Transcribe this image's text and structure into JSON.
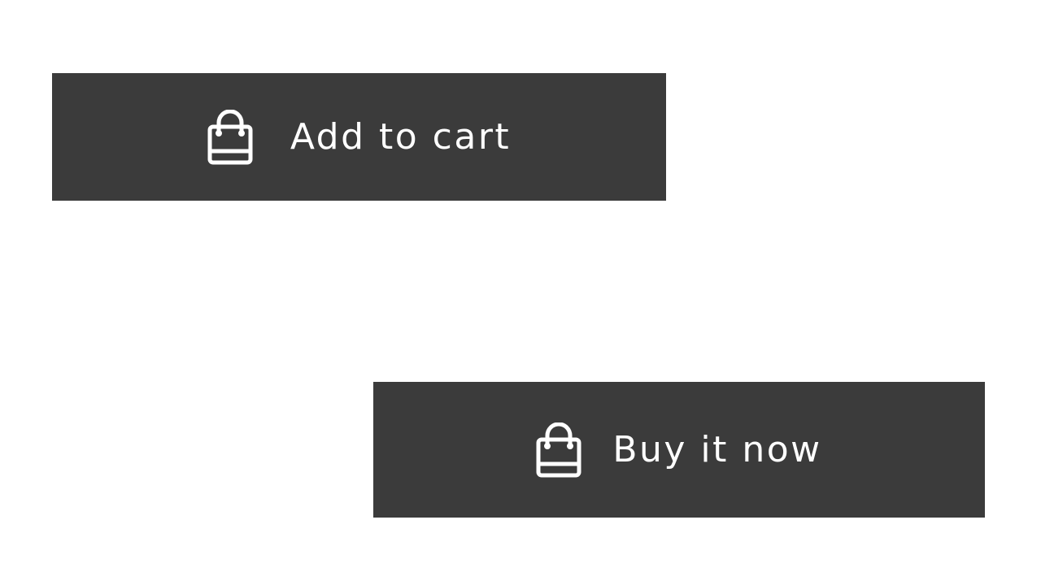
{
  "buttons": {
    "add_to_cart": {
      "label": "Add to cart",
      "icon": "shopping-bag-icon"
    },
    "buy_it_now": {
      "label": "Buy it now",
      "icon": "shopping-bag-icon"
    }
  },
  "colors": {
    "button_background": "#3b3b3b",
    "button_text": "#ffffff",
    "page_background": "#ffffff"
  }
}
